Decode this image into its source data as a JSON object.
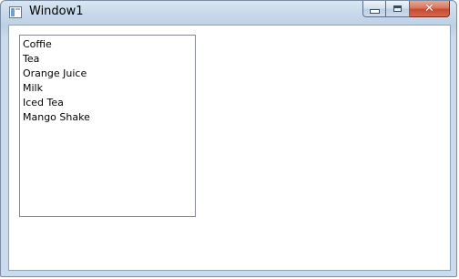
{
  "window": {
    "title": "Window1",
    "caption_buttons": {
      "minimize": "minimize",
      "maximize": "maximize",
      "close": "close"
    }
  },
  "listbox": {
    "items": [
      {
        "label": "Coffie"
      },
      {
        "label": "Tea"
      },
      {
        "label": "Orange Juice"
      },
      {
        "label": "Milk"
      },
      {
        "label": "Iced Tea"
      },
      {
        "label": "Mango Shake"
      }
    ]
  },
  "colors": {
    "titlebar": "#c8d9ea",
    "close_button": "#c54a2f",
    "listbox_border": "#828790"
  }
}
